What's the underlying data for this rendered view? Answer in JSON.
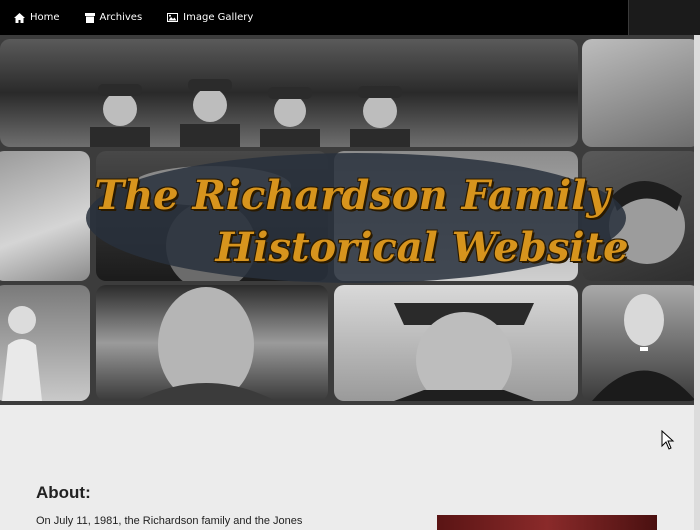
{
  "nav": {
    "items": [
      {
        "label": "Home",
        "icon": "home-icon"
      },
      {
        "label": "Archives",
        "icon": "archive-icon"
      },
      {
        "label": "Image Gallery",
        "icon": "image-icon"
      }
    ]
  },
  "banner": {
    "title_line1": "The Richardson Family",
    "title_line2": "Historical Website"
  },
  "about": {
    "heading": "About:",
    "text": "On July 11, 1981, the Richardson family and the Jones"
  },
  "colors": {
    "nav_bg": "#000000",
    "title_gold": "#d7941d",
    "page_bg": "#ececec"
  }
}
